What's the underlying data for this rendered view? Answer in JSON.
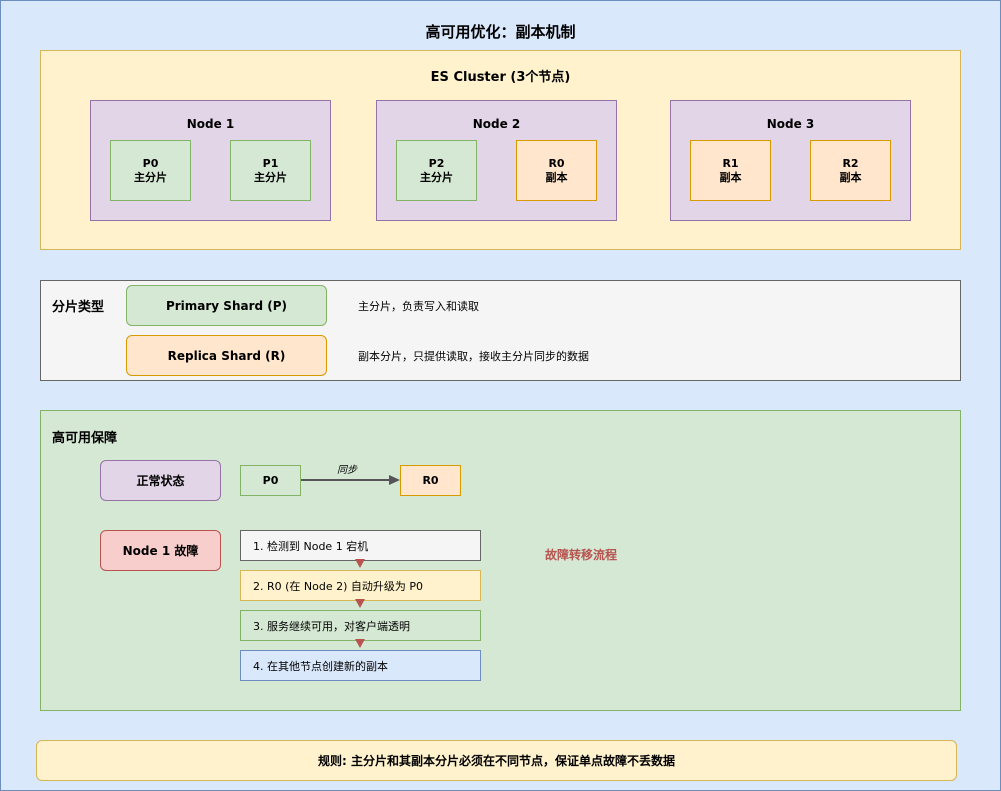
{
  "title": "高可用优化：副本机制",
  "cluster": {
    "title": "ES Cluster (3个节点)",
    "nodes": [
      {
        "name": "Node 1",
        "shards": [
          {
            "id": "P0",
            "role": "主分片"
          },
          {
            "id": "P1",
            "role": "主分片"
          }
        ]
      },
      {
        "name": "Node 2",
        "shards": [
          {
            "id": "P2",
            "role": "主分片"
          },
          {
            "id": "R0",
            "role": "副本"
          }
        ]
      },
      {
        "name": "Node 3",
        "shards": [
          {
            "id": "R1",
            "role": "副本"
          },
          {
            "id": "R2",
            "role": "副本"
          }
        ]
      }
    ]
  },
  "shard_types": {
    "title": "分片类型",
    "primary": {
      "label": "Primary Shard (P)",
      "desc": "主分片，负责写入和读取"
    },
    "replica": {
      "label": "Replica Shard (R)",
      "desc": "副本分片，只提供读取，接收主分片同步的数据"
    }
  },
  "ha": {
    "title": "高可用保障",
    "normal_state": "正常状态",
    "sync": {
      "from": "P0",
      "to": "R0",
      "label": "同步"
    },
    "failure_state": "Node 1 故障",
    "steps": [
      "1. 检测到 Node 1 宕机",
      "2. R0 (在 Node 2) 自动升级为 P0",
      "3. 服务继续可用，对客户端透明",
      "4. 在其他节点创建新的副本"
    ],
    "flow_label": "故障转移流程"
  },
  "rule": "规则: 主分片和其副本分片必须在不同节点，保证单点故障不丢数据",
  "colors": {
    "background": "#dae8fc",
    "cluster": "#fff2cc",
    "node": "#e1d5e7",
    "primary": "#d5e8d4",
    "replica": "#ffe6cc",
    "failure": "#f8cecc",
    "arrow_down": "#b85450"
  }
}
